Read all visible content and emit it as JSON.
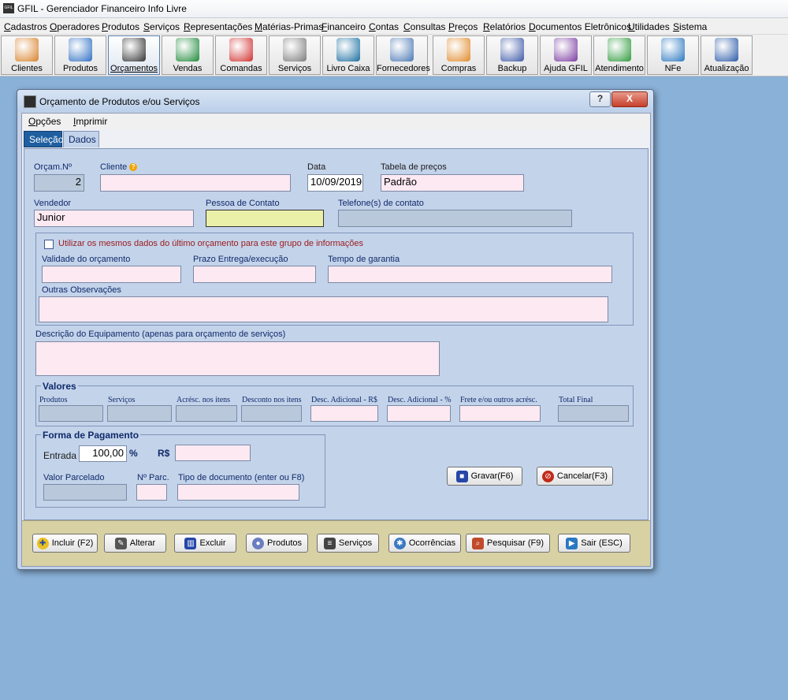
{
  "app": {
    "title": "GFIL - Gerenciador Financeiro Info Livre",
    "logo": "GFIL"
  },
  "menu": [
    "Cadastros",
    "Operadores",
    "Produtos",
    "Serviços",
    "Representações",
    "Matérias-Primas",
    "Financeiro",
    "Contas",
    "Consultas",
    "Preços",
    "Relatórios",
    "Documentos Eletrônicos",
    "Utilidades",
    "Sistema"
  ],
  "toolbar": [
    {
      "label": "Clientes",
      "icon": "clients-icon",
      "color": "#d9822b"
    },
    {
      "label": "Produtos",
      "icon": "monitor-icon",
      "color": "#2f6fc4"
    },
    {
      "label": "Orçamentos",
      "icon": "notepad-icon",
      "color": "#333333"
    },
    {
      "label": "Vendas",
      "icon": "money-bag-icon",
      "color": "#1e8a3a"
    },
    {
      "label": "Comandas",
      "icon": "plate-icon",
      "color": "#d0302e"
    },
    {
      "label": "Serviços",
      "icon": "tools-icon",
      "color": "#7c7c7c"
    },
    {
      "label": "Livro Caixa",
      "icon": "cash-book-icon",
      "color": "#1a6ea0"
    },
    {
      "label": "Fornecedores",
      "icon": "supplier-icon",
      "color": "#4a78b4"
    },
    {
      "label": "Compras",
      "icon": "boxes-icon",
      "color": "#e08a2a"
    },
    {
      "label": "Backup",
      "icon": "floppy-icon",
      "color": "#3e59a6"
    },
    {
      "label": "Ajuda GFIL",
      "icon": "help-book-icon",
      "color": "#7a3aa0"
    },
    {
      "label": "Atendimento",
      "icon": "service-board-icon",
      "color": "#2d9a3c"
    },
    {
      "label": "NFe",
      "icon": "nfe-icon",
      "color": "#2a78c0"
    },
    {
      "label": "Atualização",
      "icon": "update-icon",
      "color": "#2a5aa8"
    }
  ],
  "dialog": {
    "title": "Orçamento de Produtos e/ou Serviços",
    "help_btn": "?",
    "close_btn": "X",
    "menu": [
      "Opções",
      "Imprimir"
    ],
    "tabs": [
      "Seleção",
      "Dados"
    ],
    "labels": {
      "orcam_no": "Orçam.Nº",
      "cliente": "Cliente",
      "data": "Data",
      "tabela": "Tabela de preços",
      "vendedor": "Vendedor",
      "pessoa": "Pessoa de Contato",
      "telefone": "Telefone(s) de contato",
      "utilizar": "Utilizar os mesmos dados do último orçamento para este grupo de informações",
      "validade": "Validade do orçamento",
      "prazo": "Prazo Entrega/execução",
      "garantia": "Tempo de garantia",
      "obs": "Outras Observações",
      "descricao": "Descrição do Equipamento (apenas para orçamento de serviços)"
    },
    "values": {
      "orcam_no": "2",
      "cliente": "",
      "data": "10/09/2019",
      "tabela": "Padrão",
      "vendedor": "Junior",
      "pessoa": "",
      "telefone": ""
    },
    "valores": {
      "title": "Valores",
      "labels": [
        "Produtos",
        "Serviços",
        "Acrésc. nos itens",
        "Desconto nos itens",
        "Desc. Adicional - R$",
        "Desc. Adicional - %",
        "Frete e/ou outros acrésc.",
        "Total Final"
      ]
    },
    "pagamento": {
      "title": "Forma de Pagamento",
      "entrada_label": "Entrada",
      "entrada_value": "100,00",
      "percent": "%",
      "rs": "R$",
      "parcelado_label": "Valor Parcelado",
      "parc_label": "Nº Parc.",
      "tipo_label": "Tipo de documento  (enter ou F8)"
    },
    "actions": {
      "gravar": "Gravar(F6)",
      "cancelar": "Cancelar(F3)"
    },
    "footer": [
      "Incluir (F2)",
      "Alterar",
      "Excluir",
      "Produtos",
      "Serviços",
      "Ocorrências",
      "Pesquisar (F9)",
      "Sair (ESC)"
    ]
  }
}
